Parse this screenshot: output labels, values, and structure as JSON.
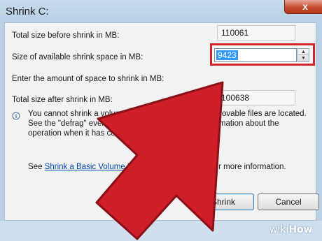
{
  "window": {
    "title": "Shrink C:",
    "close_label": "x"
  },
  "rows": [
    {
      "label": "Total size before shrink in MB:",
      "value": "110061"
    },
    {
      "label": "Size of available shrink space in MB:",
      "value": "9423"
    },
    {
      "label": "Enter the amount of space to shrink in MB:",
      "value": "9423"
    },
    {
      "label": "Total size after shrink in MB:",
      "value": "100638"
    }
  ],
  "spinner": {
    "up": "▲",
    "down": "▼"
  },
  "info": {
    "lines": [
      "You cannot shrink a volume beyond th",
      "See the \"defrag\" event in the Ap",
      "operation when it has com"
    ],
    "lines_right": [
      "unmovable files are located.",
      "d information about the",
      ""
    ]
  },
  "see": {
    "prefix": "See ",
    "link": "Shrink a Basic Volume",
    "middle": " in Di",
    "suffix": "p for more information."
  },
  "buttons": {
    "shrink": "Shrink",
    "cancel": "Cancel"
  },
  "watermark": {
    "wiki": "wiki",
    "how": "How"
  },
  "colors": {
    "arrow": "#d11f2a",
    "highlight_border": "#d4232b",
    "selection": "#3399ff"
  }
}
